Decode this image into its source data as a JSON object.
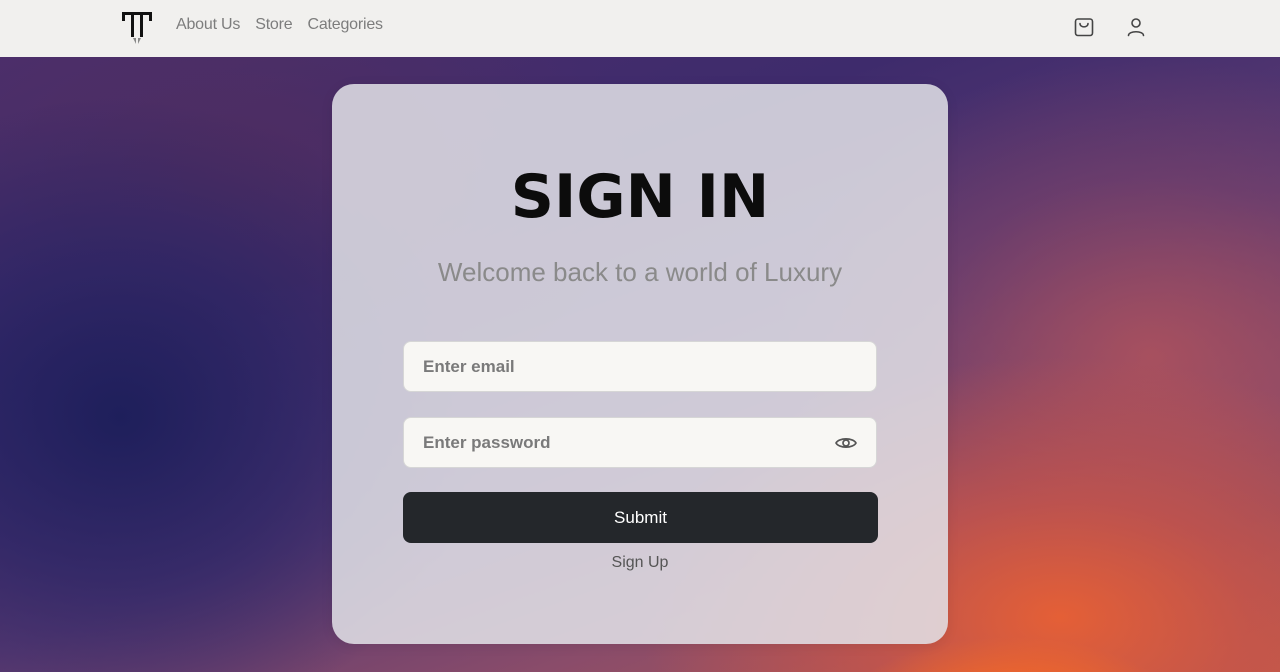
{
  "nav": {
    "logo_icon": "brand-monogram-logo",
    "links": [
      {
        "label": "About Us"
      },
      {
        "label": "Store"
      },
      {
        "label": "Categories"
      }
    ],
    "cart_icon": "shopping-bag-icon",
    "user_icon": "user-icon"
  },
  "signin": {
    "title": "SIGN IN",
    "subtitle": "Welcome back to a world of Luxury",
    "email_placeholder": "Enter email",
    "email_value": "",
    "password_placeholder": "Enter password",
    "password_value": "",
    "password_toggle_icon": "eye-icon",
    "submit_label": "Submit",
    "signup_label": "Sign Up"
  },
  "colors": {
    "navbar_bg": "#f1f0ee",
    "nav_text": "#7d7d7d",
    "button_bg": "#24272b",
    "button_text": "#ffffff",
    "title_text": "#0c0c0c",
    "subtitle_text": "#8a8a8a"
  }
}
